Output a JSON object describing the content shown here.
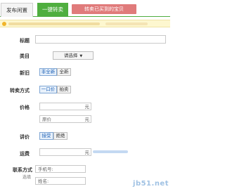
{
  "tabs": {
    "publish": "发布闲置",
    "quick_sell": "一键转卖",
    "promo": "转卖已买到的宝贝"
  },
  "form": {
    "title_label": "标题",
    "category_label": "类目",
    "category_value": "请选择",
    "condition_label": "新旧",
    "condition_options": [
      "非全新",
      "全新"
    ],
    "method_label": "转卖方式",
    "method_options": [
      "一口价",
      "拍卖"
    ],
    "price_label": "价格",
    "price_unit": "元",
    "original_price_placeholder": "原价",
    "original_price_unit": "元",
    "bargain_label": "讲价",
    "bargain_options": [
      "接受",
      "拒绝"
    ],
    "shipping_label": "运费",
    "shipping_unit": "元",
    "contact_label": "联系方式",
    "contact_sub": "选填",
    "phone_placeholder": "手机号:",
    "name_placeholder": "姓名:"
  },
  "watermark": "jb51.net",
  "colors": {
    "accent": "#4fae3f",
    "promo": "#e07b7b",
    "notice_bg": "#fdf7cf"
  }
}
